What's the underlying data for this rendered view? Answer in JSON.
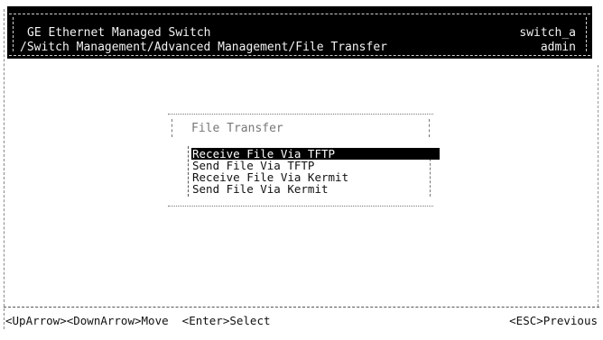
{
  "header": {
    "title": "GE Ethernet Managed Switch",
    "path": "/Switch Management/Advanced Management/File Transfer",
    "hostname": "switch_a",
    "user": "admin"
  },
  "dialog": {
    "title": "File Transfer",
    "items": [
      {
        "label": "Receive File Via TFTP",
        "selected": true
      },
      {
        "label": "Send File Via TFTP",
        "selected": false
      },
      {
        "label": "Receive File Via Kermit",
        "selected": false
      },
      {
        "label": "Send File Via Kermit",
        "selected": false
      }
    ]
  },
  "status_bar": {
    "left": "<UpArrow><DownArrow>Move  <Enter>Select",
    "right": "<ESC>Previous"
  }
}
